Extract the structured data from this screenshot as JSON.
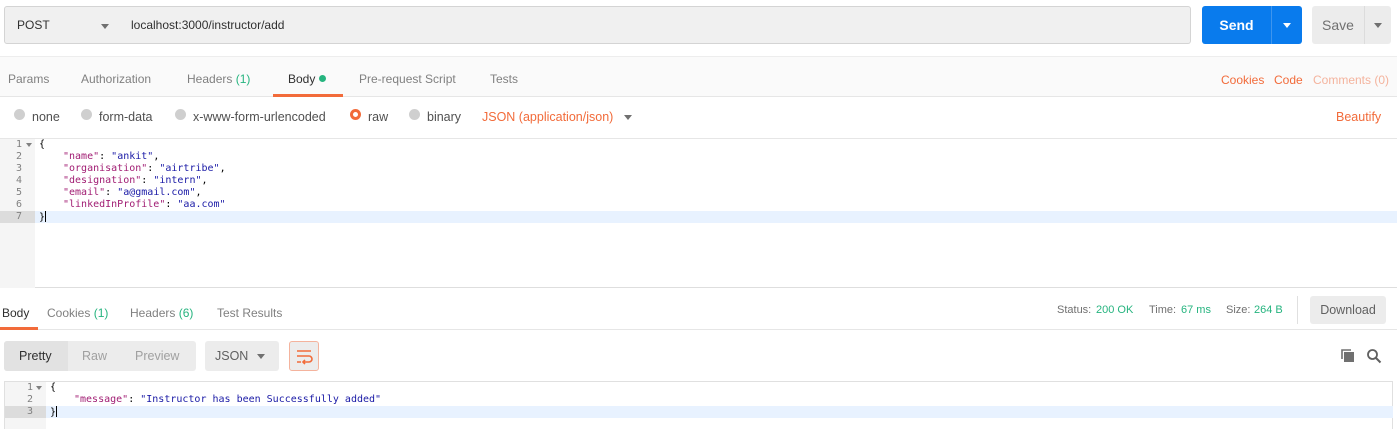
{
  "request": {
    "method": "POST",
    "url": "localhost:3000/instructor/add",
    "send_label": "Send",
    "save_label": "Save"
  },
  "request_tabs": {
    "params": "Params",
    "authorization": "Authorization",
    "headers": "Headers",
    "headers_count": "(1)",
    "body": "Body",
    "prerequest": "Pre-request Script",
    "tests": "Tests",
    "cookies": "Cookies",
    "code": "Code",
    "comments": "Comments (0)"
  },
  "body_options": {
    "none": "none",
    "form_data": "form-data",
    "urlencoded": "x-www-form-urlencoded",
    "raw": "raw",
    "binary": "binary",
    "content_type": "JSON (application/json)",
    "beautify": "Beautify",
    "selected": "raw"
  },
  "request_body": {
    "line_numbers": [
      "1",
      "2",
      "3",
      "4",
      "5",
      "6",
      "7"
    ],
    "open_brace": "{",
    "close_brace": "}",
    "fields": [
      {
        "key": "\"name\"",
        "value": "\"ankit\"",
        "comma": ","
      },
      {
        "key": "\"organisation\"",
        "value": "\"airtribe\"",
        "comma": ","
      },
      {
        "key": "\"designation\"",
        "value": "\"intern\"",
        "comma": ","
      },
      {
        "key": "\"email\"",
        "value": "\"a@gmail.com\"",
        "comma": ","
      },
      {
        "key": "\"linkedInProfile\"",
        "value": "\"aa.com\"",
        "comma": ""
      }
    ]
  },
  "response_tabs": {
    "body": "Body",
    "cookies": "Cookies",
    "cookies_count": "(1)",
    "headers": "Headers",
    "headers_count": "(6)",
    "test_results": "Test Results",
    "status_label": "Status:",
    "status_value": "200 OK",
    "time_label": "Time:",
    "time_value": "67 ms",
    "size_label": "Size:",
    "size_value": "264 B",
    "download": "Download"
  },
  "response_toolbar": {
    "pretty": "Pretty",
    "raw": "Raw",
    "preview": "Preview",
    "format": "JSON"
  },
  "response_body": {
    "line_numbers": [
      "1",
      "2",
      "3"
    ],
    "open_brace": "{",
    "close_brace": "}",
    "key": "\"message\"",
    "value": "\"Instructor has been Successfully added\""
  },
  "icons": {
    "send_dropdown": "chevron-down-icon",
    "save_dropdown": "chevron-down-icon",
    "wrap": "wrap-lines-icon",
    "copy": "copy-icon",
    "search": "search-icon"
  },
  "colors": {
    "accent": "#f26b3a",
    "primary": "#097bed",
    "success": "#26b47f"
  }
}
